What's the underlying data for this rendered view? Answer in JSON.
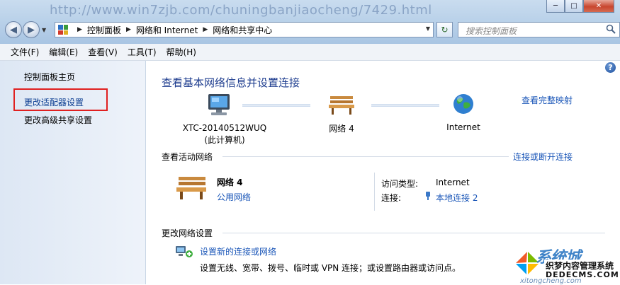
{
  "window": {
    "bg_url_text": "http://www.win7zjb.com/chuningbanjiaocheng/7429.html",
    "controls": {
      "minimize": "─",
      "maximize": "□",
      "close": "✕"
    }
  },
  "address": {
    "breadcrumbs": [
      "控制面板",
      "网络和 Internet",
      "网络和共享中心"
    ],
    "search_placeholder": "搜索控制面板"
  },
  "menu": [
    "文件(F)",
    "编辑(E)",
    "查看(V)",
    "工具(T)",
    "帮助(H)"
  ],
  "sidebar": {
    "home": "控制面板主页",
    "items": [
      "更改适配器设置",
      "更改高级共享设置"
    ],
    "highlight_color": "#e02020"
  },
  "main": {
    "help": "?",
    "title": "查看基本网络信息并设置连接",
    "map": {
      "computer_name": "XTC-20140512WUQ",
      "computer_sub": "(此计算机)",
      "network": "网络  4",
      "internet": "Internet",
      "full_map_link": "查看完整映射"
    },
    "active": {
      "section_title": "查看活动网络",
      "connect_link": "连接或断开连接",
      "network_name": "网络  4",
      "network_type": "公用网络",
      "access_label": "访问类型:",
      "access_value": "Internet",
      "connection_label": "连接:",
      "connection_value": "本地连接 2"
    },
    "change": {
      "section_title": "更改网络设置",
      "setup_link": "设置新的连接或网络",
      "setup_desc": "设置无线、宽带、拨号、临时或 VPN 连接；或设置路由器或访问点。"
    }
  },
  "watermark": {
    "brand": "系统城",
    "line1": "织梦内容管理系统",
    "line2": "DEDECMS.COM",
    "site": "xitongcheng.com"
  },
  "colors": {
    "link": "#1a56b8",
    "heading": "#1e3d8f",
    "accent_red": "#e02020"
  }
}
